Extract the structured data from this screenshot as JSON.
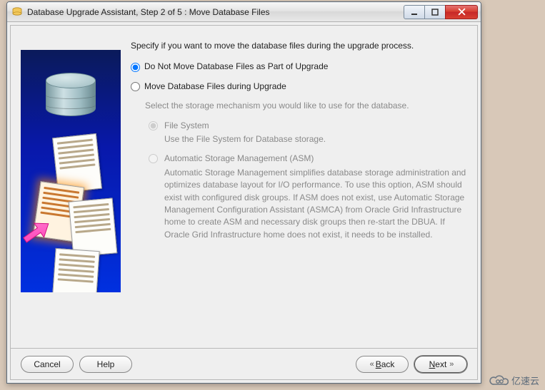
{
  "window": {
    "title": "Database Upgrade Assistant, Step 2 of 5 : Move Database Files"
  },
  "content": {
    "intro": "Specify if you want to move the database files during the upgrade process.",
    "option_no_move": "Do Not Move Database Files as Part of Upgrade",
    "option_move": "Move Database Files during Upgrade",
    "selected_option": "no_move",
    "storage_intro": "Select the storage mechanism you would like to use for the database.",
    "fs": {
      "title": "File System",
      "desc": "Use the File System for Database storage."
    },
    "asm": {
      "title": "Automatic Storage Management (ASM)",
      "desc": "Automatic Storage Management simplifies database storage administration and optimizes database layout for I/O performance. To use this option, ASM should exist with configured disk groups. If ASM does not exist, use Automatic Storage Management Configuration Assistant (ASMCA) from Oracle Grid Infrastructure home to create ASM and necessary disk groups then re-start the DBUA. If Oracle Grid Infrastructure home does not exist, it needs to be installed."
    },
    "storage_selected": "fs"
  },
  "buttons": {
    "cancel": "Cancel",
    "help": "Help",
    "back": "Back",
    "next": "Next"
  },
  "watermark": "亿速云"
}
